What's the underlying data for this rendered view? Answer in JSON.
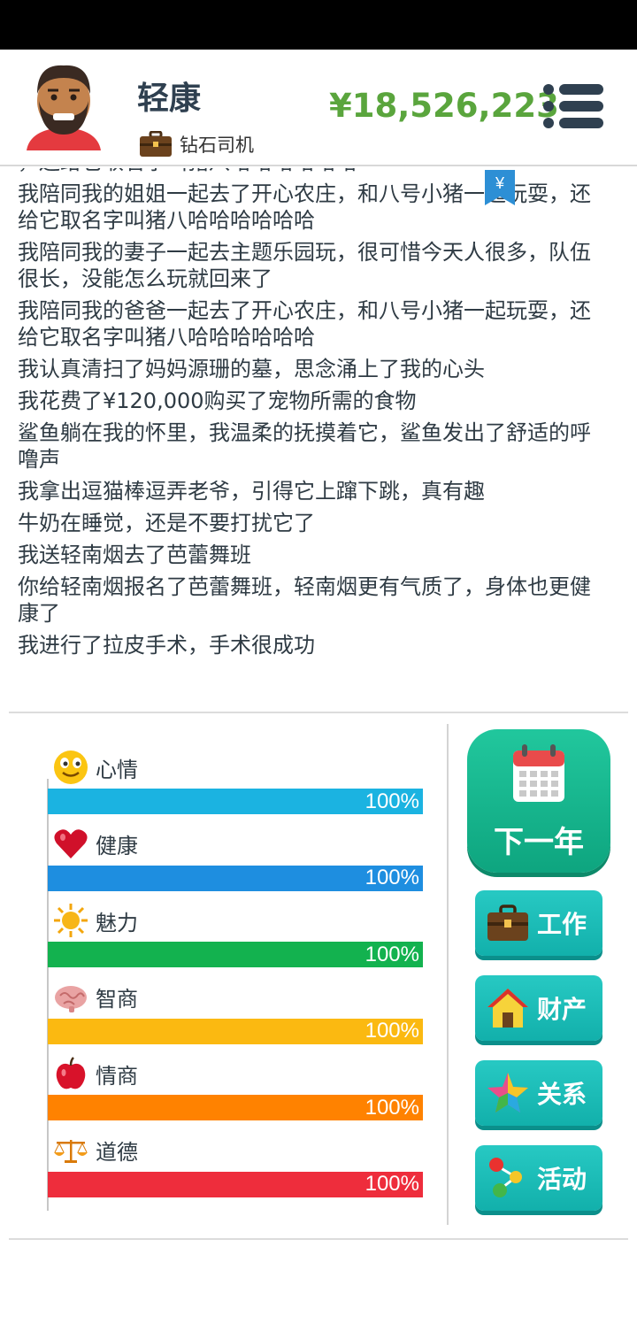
{
  "player": {
    "name": "轻康",
    "job": "钻石司机",
    "money": "¥18,526,223"
  },
  "tag": {
    "symbol": "¥"
  },
  "log": [
    "，还给它取名字叫猪八哈哈哈哈哈哈",
    "我陪同我的姐姐一起去了开心农庄，和八号小猪一起玩耍，还给它取名字叫猪八哈哈哈哈哈哈",
    "我陪同我的妻子一起去主题乐园玩，很可惜今天人很多，队伍很长，没能怎么玩就回来了",
    "我陪同我的爸爸一起去了开心农庄，和八号小猪一起玩耍，还给它取名字叫猪八哈哈哈哈哈哈",
    "我认真清扫了妈妈源珊的墓，思念涌上了我的心头",
    "我花费了¥120,000购买了宠物所需的食物",
    "鲨鱼躺在我的怀里，我温柔的抚摸着它，鲨鱼发出了舒适的呼噜声",
    "我拿出逗猫棒逗弄老爷，引得它上蹿下跳，真有趣",
    "牛奶在睡觉，还是不要打扰它了",
    "我送轻南烟去了芭蕾舞班",
    "你给轻南烟报名了芭蕾舞班，轻南烟更有气质了，身体也更健康了",
    "我进行了拉皮手术，手术很成功"
  ],
  "stats": [
    {
      "label": "心情",
      "value": "100%",
      "percent": 100,
      "color": "#1bb3e1",
      "icon": "smiley-icon"
    },
    {
      "label": "健康",
      "value": "100%",
      "percent": 100,
      "color": "#1e8ee0",
      "icon": "heart-icon"
    },
    {
      "label": "魅力",
      "value": "100%",
      "percent": 100,
      "color": "#13b24f",
      "icon": "sun-icon"
    },
    {
      "label": "智商",
      "value": "100%",
      "percent": 100,
      "color": "#fbb911",
      "icon": "brain-icon"
    },
    {
      "label": "情商",
      "value": "100%",
      "percent": 100,
      "color": "#ff8200",
      "icon": "apple-icon"
    },
    {
      "label": "道德",
      "value": "100%",
      "percent": 100,
      "color": "#ee2d3c",
      "icon": "scales-icon"
    }
  ],
  "actions": {
    "next_year": "下一年",
    "work": "工作",
    "property": "财产",
    "relations": "关系",
    "activities": "活动"
  },
  "colors": {
    "money": "#5aa53d",
    "next_year": "#17b58e",
    "side_button": "#1bbdb8"
  }
}
